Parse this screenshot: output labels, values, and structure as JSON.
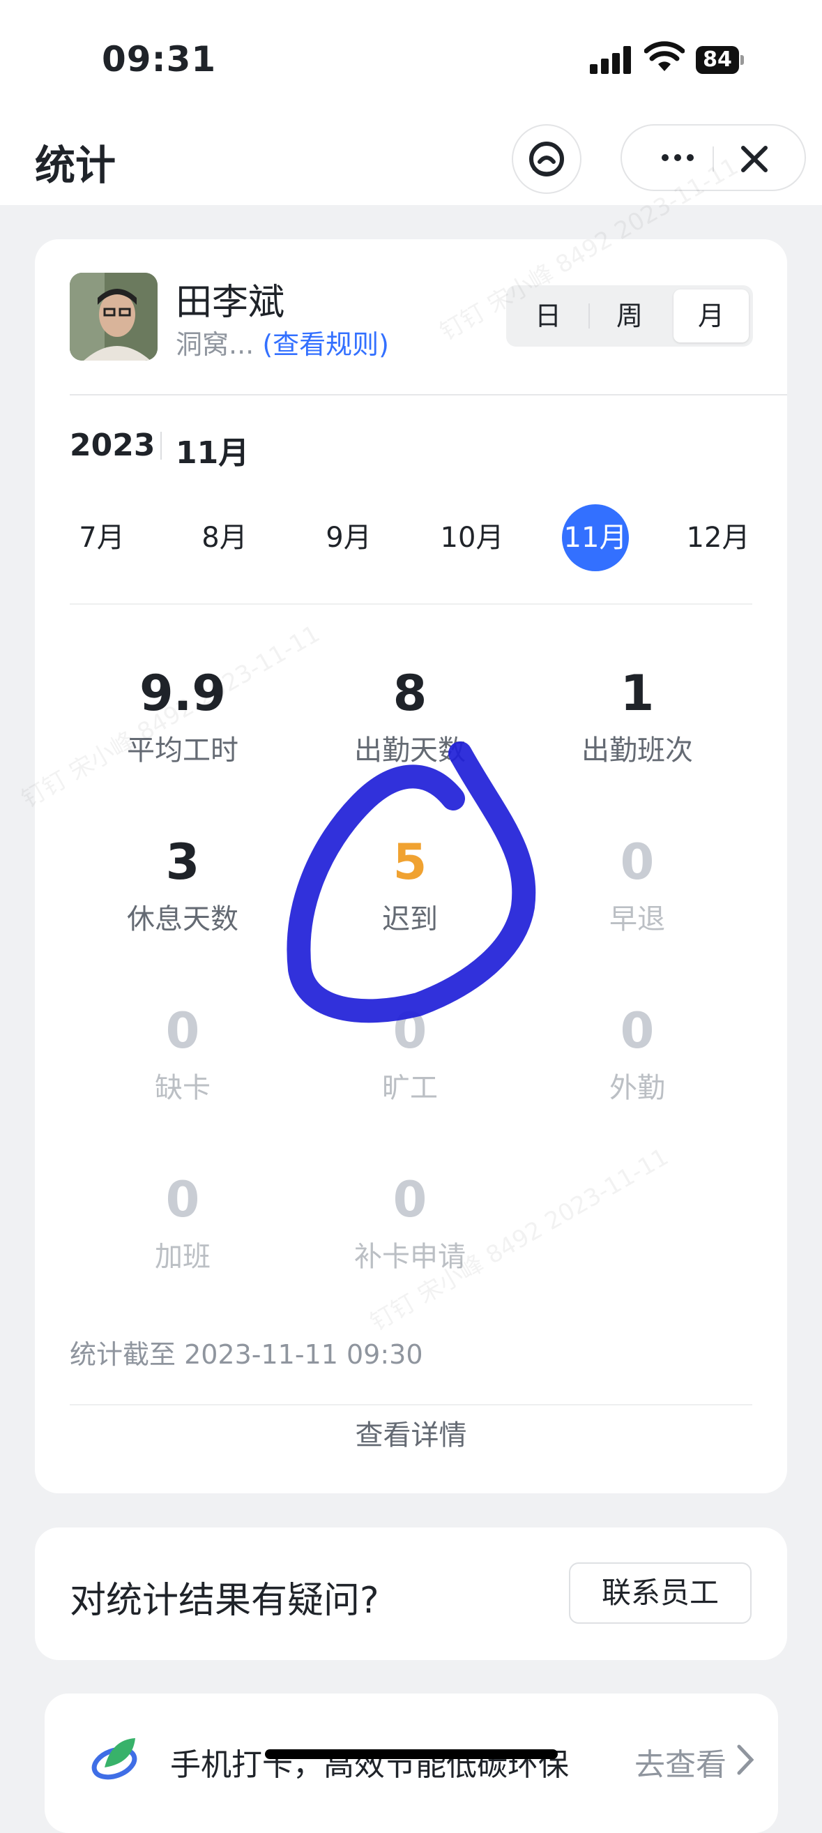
{
  "status_bar": {
    "time": "09:31",
    "battery": "84"
  },
  "header": {
    "title": "统计"
  },
  "user": {
    "name": "田李斌",
    "group": "洞窝...",
    "rules_link": "(查看规则)"
  },
  "period_tabs": [
    {
      "label": "日"
    },
    {
      "label": "周"
    },
    {
      "label": "月",
      "active": true
    }
  ],
  "date": {
    "year": "2023",
    "month": "11月"
  },
  "months": [
    "7月",
    "8月",
    "9月",
    "10月",
    "11月",
    "12月"
  ],
  "selected_month": "11月",
  "stats": [
    {
      "value": "9.9",
      "label": "平均工时"
    },
    {
      "value": "8",
      "label": "出勤天数"
    },
    {
      "value": "1",
      "label": "出勤班次"
    },
    {
      "value": "3",
      "label": "休息天数"
    },
    {
      "value": "5",
      "label": "迟到"
    },
    {
      "value": "0",
      "label": "早退"
    },
    {
      "value": "0",
      "label": "缺卡"
    },
    {
      "value": "0",
      "label": "旷工"
    },
    {
      "value": "0",
      "label": "外勤"
    },
    {
      "value": "0",
      "label": "加班"
    },
    {
      "value": "0",
      "label": "补卡申请"
    }
  ],
  "cutoff": "统计截至 2023-11-11 09:30",
  "detail_link": "查看详情",
  "question": {
    "text": "对统计结果有疑问?",
    "button": "联系员工"
  },
  "promo": {
    "text": "手机打卡，高效节能低碳环保",
    "action": "去查看"
  },
  "watermark": "钉钉 宋小峰 8492 2023-11-11",
  "colors": {
    "accent": "#3370ff",
    "late": "#f0a231",
    "scribble": "#2020d8"
  }
}
